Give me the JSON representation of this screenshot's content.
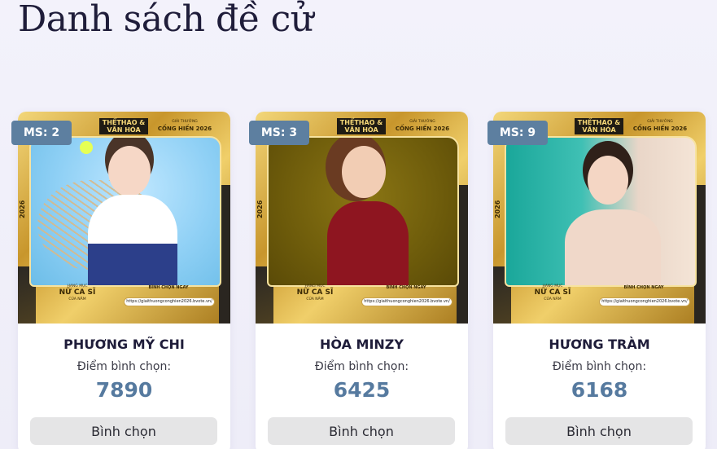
{
  "page": {
    "title": "Danh sách đề cử"
  },
  "poster_common": {
    "brand": "THỂTHAO & VĂN HÓA",
    "award_small": "GIẢI THƯỞNG",
    "award": "CỐNG HIẾN 2026",
    "year": "2026",
    "category_l1": "HẠNG MỤC",
    "category_l2": "NỮ CA SĨ",
    "category_l3": "CỦA NĂM",
    "vote_now": "BÌNH CHỌN NGAY",
    "vote_url": "https://giaithuongconghien2026.bvote.vn/"
  },
  "candidates": [
    {
      "ms": "MS: 2",
      "name": "PHƯƠNG MỸ CHI",
      "score_label": "Điểm bình chọn:",
      "score": "7890",
      "button": "Bình chọn"
    },
    {
      "ms": "MS: 3",
      "name": "HÒA MINZY",
      "score_label": "Điểm bình chọn:",
      "score": "6425",
      "button": "Bình chọn"
    },
    {
      "ms": "MS: 9",
      "name": "HƯƠNG TRÀM",
      "score_label": "Điểm bình chọn:",
      "score": "6168",
      "button": "Bình chọn"
    }
  ],
  "colors": {
    "badge": "#5d7fa0",
    "score": "#567a9f",
    "button": "#e5e5e6",
    "title": "#1f1d3a"
  }
}
